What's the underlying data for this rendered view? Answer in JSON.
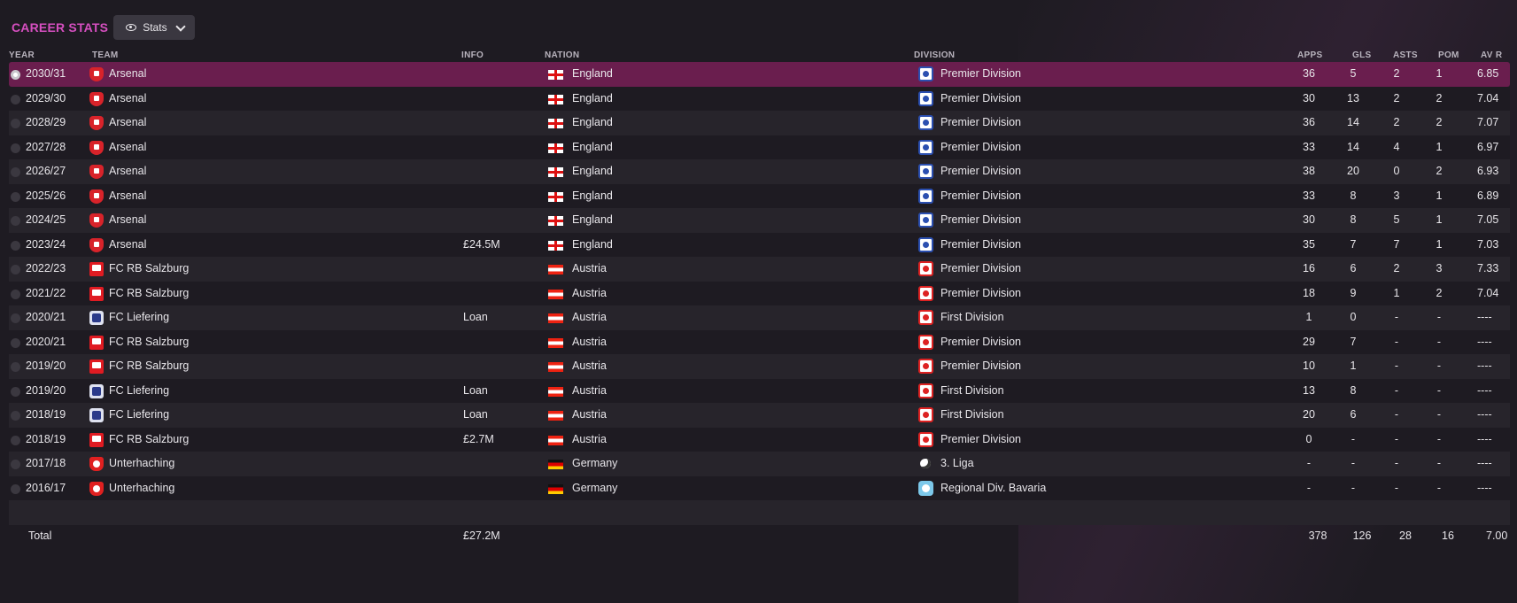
{
  "header": {
    "title": "CAREER STATS",
    "view_button_label": "Stats"
  },
  "columns": {
    "year": "YEAR",
    "team": "TEAM",
    "info": "INFO",
    "nation": "NATION",
    "division": "DIVISION",
    "apps": "APPS",
    "gls": "GLS",
    "asts": "ASTS",
    "pom": "POM",
    "avr": "AV R"
  },
  "rows": [
    {
      "year": "2030/31",
      "team": "Arsenal",
      "team_icon": "arsenal-crest-icon",
      "info": "",
      "nation": "England",
      "nation_icon": "england-flag-icon",
      "division": "Premier Division",
      "division_icon": "english-premier-division-icon",
      "apps": "36",
      "gls": "5",
      "asts": "2",
      "pom": "1",
      "avr": "6.85",
      "selected": true
    },
    {
      "year": "2029/30",
      "team": "Arsenal",
      "team_icon": "arsenal-crest-icon",
      "info": "",
      "nation": "England",
      "nation_icon": "england-flag-icon",
      "division": "Premier Division",
      "division_icon": "english-premier-division-icon",
      "apps": "30",
      "gls": "13",
      "asts": "2",
      "pom": "2",
      "avr": "7.04"
    },
    {
      "year": "2028/29",
      "team": "Arsenal",
      "team_icon": "arsenal-crest-icon",
      "info": "",
      "nation": "England",
      "nation_icon": "england-flag-icon",
      "division": "Premier Division",
      "division_icon": "english-premier-division-icon",
      "apps": "36",
      "gls": "14",
      "asts": "2",
      "pom": "2",
      "avr": "7.07"
    },
    {
      "year": "2027/28",
      "team": "Arsenal",
      "team_icon": "arsenal-crest-icon",
      "info": "",
      "nation": "England",
      "nation_icon": "england-flag-icon",
      "division": "Premier Division",
      "division_icon": "english-premier-division-icon",
      "apps": "33",
      "gls": "14",
      "asts": "4",
      "pom": "1",
      "avr": "6.97"
    },
    {
      "year": "2026/27",
      "team": "Arsenal",
      "team_icon": "arsenal-crest-icon",
      "info": "",
      "nation": "England",
      "nation_icon": "england-flag-icon",
      "division": "Premier Division",
      "division_icon": "english-premier-division-icon",
      "apps": "38",
      "gls": "20",
      "asts": "0",
      "pom": "2",
      "avr": "6.93"
    },
    {
      "year": "2025/26",
      "team": "Arsenal",
      "team_icon": "arsenal-crest-icon",
      "info": "",
      "nation": "England",
      "nation_icon": "england-flag-icon",
      "division": "Premier Division",
      "division_icon": "english-premier-division-icon",
      "apps": "33",
      "gls": "8",
      "asts": "3",
      "pom": "1",
      "avr": "6.89"
    },
    {
      "year": "2024/25",
      "team": "Arsenal",
      "team_icon": "arsenal-crest-icon",
      "info": "",
      "nation": "England",
      "nation_icon": "england-flag-icon",
      "division": "Premier Division",
      "division_icon": "english-premier-division-icon",
      "apps": "30",
      "gls": "8",
      "asts": "5",
      "pom": "1",
      "avr": "7.05"
    },
    {
      "year": "2023/24",
      "team": "Arsenal",
      "team_icon": "arsenal-crest-icon",
      "info": "£24.5M",
      "nation": "England",
      "nation_icon": "england-flag-icon",
      "division": "Premier Division",
      "division_icon": "english-premier-division-icon",
      "apps": "35",
      "gls": "7",
      "asts": "7",
      "pom": "1",
      "avr": "7.03"
    },
    {
      "year": "2022/23",
      "team": "FC RB Salzburg",
      "team_icon": "salzburg-crest-icon",
      "info": "",
      "nation": "Austria",
      "nation_icon": "austria-flag-icon",
      "division": "Premier Division",
      "division_icon": "austrian-premier-division-icon",
      "apps": "16",
      "gls": "6",
      "asts": "2",
      "pom": "3",
      "avr": "7.33"
    },
    {
      "year": "2021/22",
      "team": "FC RB Salzburg",
      "team_icon": "salzburg-crest-icon",
      "info": "",
      "nation": "Austria",
      "nation_icon": "austria-flag-icon",
      "division": "Premier Division",
      "division_icon": "austrian-premier-division-icon",
      "apps": "18",
      "gls": "9",
      "asts": "1",
      "pom": "2",
      "avr": "7.04"
    },
    {
      "year": "2020/21",
      "team": "FC Liefering",
      "team_icon": "liefering-crest-icon",
      "info": "Loan",
      "nation": "Austria",
      "nation_icon": "austria-flag-icon",
      "division": "First Division",
      "division_icon": "austrian-first-division-icon",
      "apps": "1",
      "gls": "0",
      "asts": "-",
      "pom": "-",
      "avr": "----"
    },
    {
      "year": "2020/21",
      "team": "FC RB Salzburg",
      "team_icon": "salzburg-crest-icon",
      "info": "",
      "nation": "Austria",
      "nation_icon": "austria-flag-icon",
      "division": "Premier Division",
      "division_icon": "austrian-premier-division-icon",
      "apps": "29",
      "gls": "7",
      "asts": "-",
      "pom": "-",
      "avr": "----"
    },
    {
      "year": "2019/20",
      "team": "FC RB Salzburg",
      "team_icon": "salzburg-crest-icon",
      "info": "",
      "nation": "Austria",
      "nation_icon": "austria-flag-icon",
      "division": "Premier Division",
      "division_icon": "austrian-premier-division-icon",
      "apps": "10",
      "gls": "1",
      "asts": "-",
      "pom": "-",
      "avr": "----"
    },
    {
      "year": "2019/20",
      "team": "FC Liefering",
      "team_icon": "liefering-crest-icon",
      "info": "Loan",
      "nation": "Austria",
      "nation_icon": "austria-flag-icon",
      "division": "First Division",
      "division_icon": "austrian-first-division-icon",
      "apps": "13",
      "gls": "8",
      "asts": "-",
      "pom": "-",
      "avr": "----"
    },
    {
      "year": "2018/19",
      "team": "FC Liefering",
      "team_icon": "liefering-crest-icon",
      "info": "Loan",
      "nation": "Austria",
      "nation_icon": "austria-flag-icon",
      "division": "First Division",
      "division_icon": "austrian-first-division-icon",
      "apps": "20",
      "gls": "6",
      "asts": "-",
      "pom": "-",
      "avr": "----"
    },
    {
      "year": "2018/19",
      "team": "FC RB Salzburg",
      "team_icon": "salzburg-crest-icon",
      "info": "£2.7M",
      "nation": "Austria",
      "nation_icon": "austria-flag-icon",
      "division": "Premier Division",
      "division_icon": "austrian-premier-division-icon",
      "apps": "0",
      "gls": "-",
      "asts": "-",
      "pom": "-",
      "avr": "----"
    },
    {
      "year": "2017/18",
      "team": "Unterhaching",
      "team_icon": "unterhaching-crest-icon",
      "info": "",
      "nation": "Germany",
      "nation_icon": "germany-flag-icon",
      "division": "3. Liga",
      "division_icon": "german-3-liga-icon",
      "apps": "-",
      "gls": "-",
      "asts": "-",
      "pom": "-",
      "avr": "----"
    },
    {
      "year": "2016/17",
      "team": "Unterhaching",
      "team_icon": "unterhaching-crest-icon",
      "info": "",
      "nation": "Germany",
      "nation_icon": "germany-flag-icon",
      "division": "Regional Div. Bavaria",
      "division_icon": "regional-div-bavaria-icon",
      "apps": "-",
      "gls": "-",
      "asts": "-",
      "pom": "-",
      "avr": "----"
    }
  ],
  "total": {
    "label": "Total",
    "info": "£27.2M",
    "apps": "378",
    "gls": "126",
    "asts": "28",
    "pom": "16",
    "avr": "7.00"
  },
  "colors": {
    "title": "#d64fc0",
    "selected_row": "#6a1e4e",
    "background": "#1e1b22",
    "alt_row": "#27242b"
  }
}
